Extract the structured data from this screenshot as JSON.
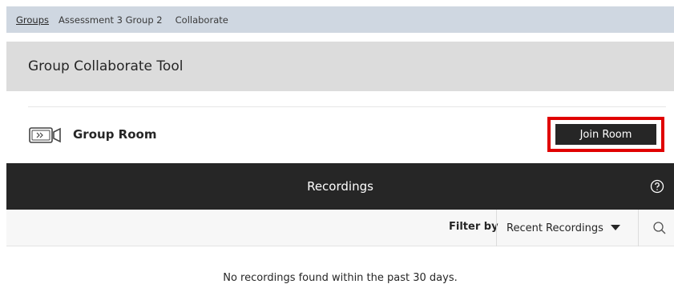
{
  "breadcrumb": {
    "items": [
      "Groups",
      "Assessment 3 Group 2",
      "Collaborate"
    ]
  },
  "page": {
    "title": "Group Collaborate Tool"
  },
  "room": {
    "icon": "video-camera-icon",
    "name": "Group Room",
    "join_label": "Join Room",
    "highlight_color": "#e00000"
  },
  "recordings": {
    "title": "Recordings",
    "help_icon": "help-circle-icon",
    "filter_label": "Filter by",
    "filter_value": "Recent Recordings",
    "search_icon": "search-icon",
    "empty_message": "No recordings found within the past 30 days."
  },
  "colors": {
    "breadcrumb_bg": "#cfd7e1",
    "title_bg": "#dcdcdc",
    "dark_header": "#262626"
  }
}
